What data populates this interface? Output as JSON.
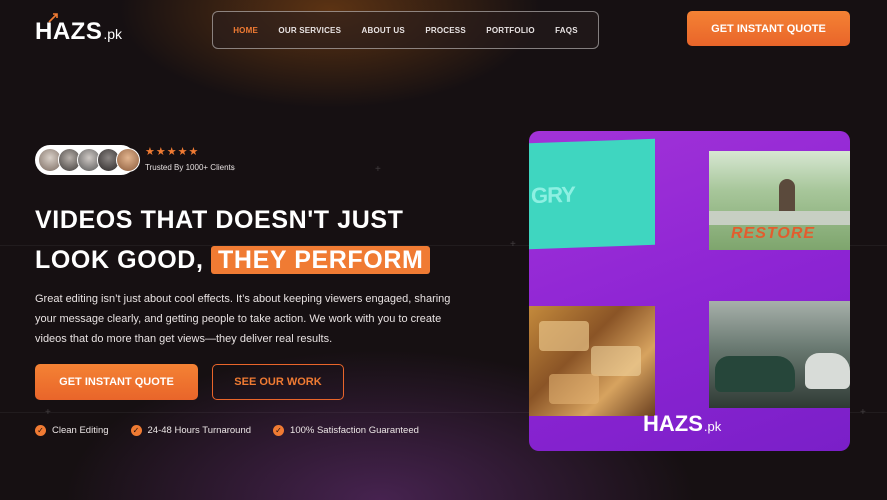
{
  "brand": {
    "logo_main": "HAZS",
    "logo_sub": ".pk"
  },
  "nav": {
    "items": [
      {
        "label": "HOME",
        "active": true
      },
      {
        "label": "OUR SERVICES",
        "active": false
      },
      {
        "label": "ABOUT US",
        "active": false
      },
      {
        "label": "PROCESS",
        "active": false
      },
      {
        "label": "PORTFOLIO",
        "active": false
      },
      {
        "label": "FAQS",
        "active": false
      }
    ]
  },
  "header": {
    "cta_label": "GET INSTANT QUOTE"
  },
  "trust": {
    "stars": "★★★★★",
    "rating": 5,
    "text": "Trusted By 1000+ Clients"
  },
  "hero": {
    "headline_line1": "VIDEOS THAT DOESN'T JUST",
    "headline_line2": "LOOK GOOD,",
    "headline_accent": "THEY PERFORM",
    "paragraph": "Great editing isn’t just about cool effects. It’s about keeping viewers engaged, sharing your message clearly, and getting people to take action. We work with you to create videos that do more than get views—they deliver real results.",
    "primary_cta": "GET INSTANT QUOTE",
    "secondary_cta": "SEE OUR WORK",
    "features": [
      "Clean Editing",
      "24-48 Hours Turnaround",
      "100% Satisfaction Guaranteed"
    ]
  },
  "media": {
    "teal_text": "GRY",
    "restore_text": "RESTORE",
    "logo_main": "HAZS",
    "logo_sub": ".pk"
  },
  "colors": {
    "accent": "#f07b33",
    "background": "#161012",
    "media_purple": "#8e25d4",
    "teal": "#3fd6c0"
  },
  "icons": {
    "check": "check-circle-icon",
    "star": "star-icon",
    "rocket": "rocket-icon"
  }
}
